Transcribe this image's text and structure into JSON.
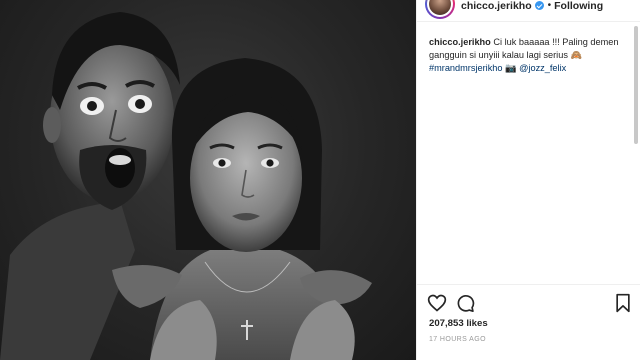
{
  "post": {
    "username": "chicco.jerikho",
    "follow_status": "Following",
    "separator": "•",
    "caption": {
      "username": "chicco.jerikho",
      "text": "Ci luk baaaaa !!! Paling demen gangguin si unyiii kalau lagi serius",
      "emoji": "🙈",
      "hashtag": "#mrandmrsjerikho",
      "camera_emoji": "📷",
      "mention": "@jozz_felix"
    },
    "likes": "207,853 likes",
    "timestamp": "17 HOURS AGO"
  },
  "icons": {
    "like": "heart-icon",
    "comment": "comment-icon",
    "save": "bookmark-icon",
    "verified": "verified-badge-icon"
  },
  "colors": {
    "verified": "#3897f0",
    "link": "#003569",
    "text": "#262626",
    "muted": "#999999"
  }
}
